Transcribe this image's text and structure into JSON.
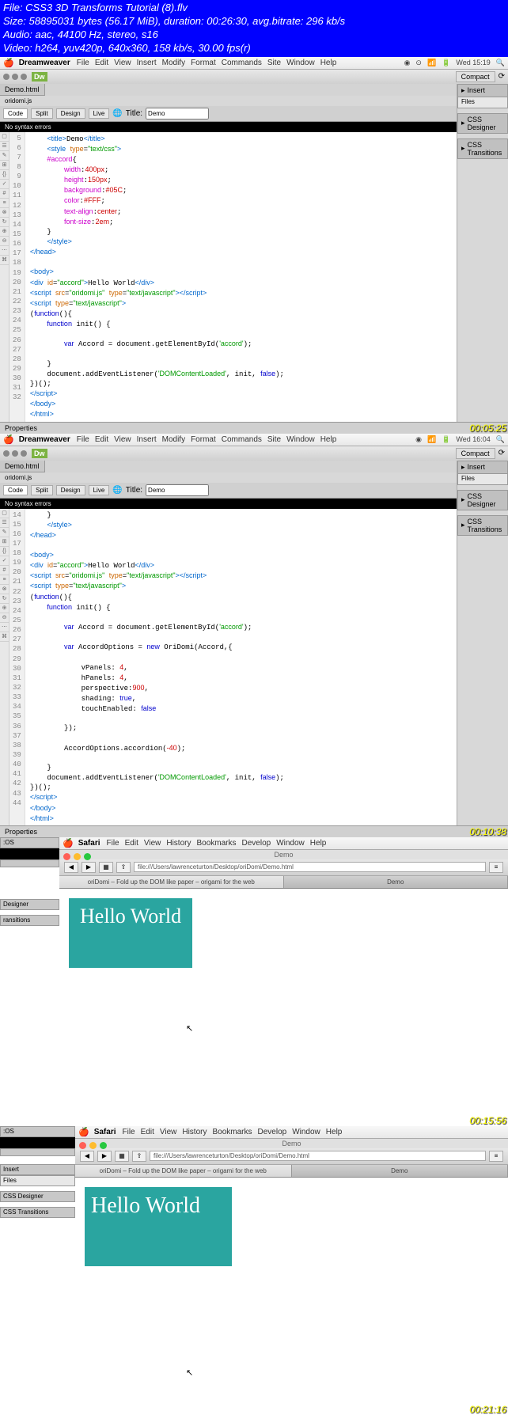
{
  "file_info": {
    "line1": "File: CSS3 3D Transforms Tutorial (8).flv",
    "line2": "Size: 58895031 bytes (56.17 MiB), duration: 00:26:30, avg.bitrate: 296 kb/s",
    "line3": "Audio: aac, 44100 Hz, stereo, s16",
    "line4": "Video: h264, yuv420p, 640x360, 158 kb/s, 30.00 fps(r)"
  },
  "mac_menu": {
    "app_dw": "Dreamweaver",
    "app_safari": "Safari",
    "items_dw": [
      "File",
      "Edit",
      "View",
      "Insert",
      "Modify",
      "Format",
      "Commands",
      "Site",
      "Window",
      "Help"
    ],
    "items_safari": [
      "File",
      "Edit",
      "View",
      "History",
      "Bookmarks",
      "Develop",
      "Window",
      "Help"
    ],
    "clock1": "Wed 15:19",
    "clock2": "Wed 16:04"
  },
  "dw": {
    "compact": "Compact",
    "file_tab": "Demo.html",
    "sub_tab": "oridomi.js",
    "toolbar": {
      "code": "Code",
      "split": "Split",
      "design": "Design",
      "live": "Live",
      "title_label": "Title:",
      "title_value": "Demo"
    },
    "syntax_msg": "No syntax errors",
    "properties": "Properties"
  },
  "panels": {
    "insert": "Insert",
    "files": "Files",
    "css_designer": "CSS Designer",
    "css_transitions": "CSS Transitions"
  },
  "code1": {
    "lines": [
      "5",
      "6",
      "7",
      "8",
      "9",
      "10",
      "11",
      "12",
      "13",
      "14",
      "15",
      "16",
      "17",
      "18",
      "19",
      "20",
      "21",
      "22",
      "23",
      "24",
      "25",
      "26",
      "27",
      "28",
      "29",
      "30",
      "31",
      "32"
    ],
    "l5": "    <title>Demo</title>",
    "l6": "    <style type=\"text/css\">",
    "l7": "    #accord{",
    "l8": "        width:400px;",
    "l9": "        height:150px;",
    "l10": "        background:#05C;",
    "l11": "        color:#FFF;",
    "l12": "        text-align:center;",
    "l13": "        font-size:2em;",
    "l14": "    }",
    "l15": "    </style>",
    "l16": "</head>",
    "l17": "",
    "l18": "<body>",
    "l19": "<div id=\"accord\">Hello World</div>",
    "l20": "<script src=\"oridomi.js\" type=\"text/javascript\"></script>",
    "l21": "<script type=\"text/javascript\">",
    "l22": "(function(){",
    "l23": "    function init() {",
    "l24": "",
    "l25": "        var Accord = document.getElementById('accord');",
    "l26": "",
    "l27": "    }",
    "l28": "    document.addEventListener('DOMContentLoaded', init, false);",
    "l29": "})();",
    "l30": "</script>",
    "l31": "</body>",
    "l32": "</html>"
  },
  "code2": {
    "lines": [
      "14",
      "15",
      "16",
      "17",
      "18",
      "19",
      "20",
      "21",
      "22",
      "23",
      "24",
      "25",
      "26",
      "27",
      "28",
      "29",
      "30",
      "31",
      "32",
      "33",
      "34",
      "35",
      "36",
      "37",
      "38",
      "39",
      "40",
      "41",
      "42",
      "43",
      "44"
    ],
    "l16": "</head>",
    "l18": "<body>",
    "l19": "<div id=\"accord\">Hello World</div>",
    "l20": "<script src=\"oridomi.js\" type=\"text/javascript\"></script>",
    "l21": "<script type=\"text/javascript\">",
    "l22": "(function(){",
    "l23": "    function init() {",
    "l25": "        var Accord = document.getElementById('accord');",
    "l27": "        var AccordOptions = new OriDomi(Accord,{",
    "l29": "            vPanels: 4,",
    "l30": "            hPanels: 4,",
    "l31": "            perspective:900,",
    "l32": "            shading: true,",
    "l33": "            touchEnabled: false",
    "l35": "        });",
    "l37": "        AccordOptions.accordion(-40);",
    "l39": "    }",
    "l40": "    document.addEventListener('DOMContentLoaded', init, false);",
    "l41": "})();",
    "l42": "</script>",
    "l43": "</body>",
    "l44": "</html>"
  },
  "safari": {
    "title": "Demo",
    "url1": "file:///Users/lawrenceturton/Desktop/oriDomi/Demo.html",
    "url2": "file:///Users/lawrenceturton/Desktop/oriDomi/Demo.html",
    "tab1": "oriDomi – Fold up the DOM like paper – origami for the web",
    "tab2": "Demo",
    "hello": "Hello World"
  },
  "timestamps": {
    "t1": "00:05:25",
    "t2": "00:10:38",
    "t3": "00:15:56",
    "t4": "00:21:16"
  },
  "left_panels": {
    "os": ":OS",
    "designer": "Designer",
    "transitions": "ransitions",
    "insert": "Insert",
    "files": "Files",
    "css_d": "CSS Designer",
    "css_t": "CSS Transitions"
  }
}
